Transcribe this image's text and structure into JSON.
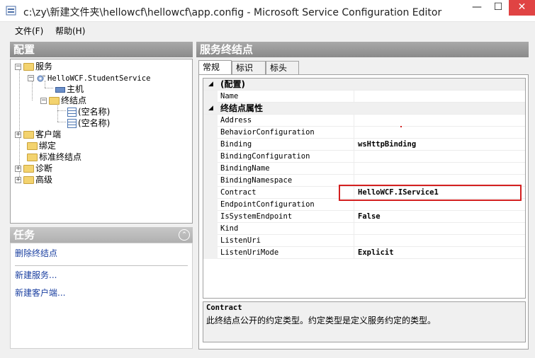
{
  "window": {
    "title": "c:\\zy\\新建文件夹\\hellowcf\\hellowcf\\app.config - Microsoft Service Configuration Editor",
    "min": "—",
    "max": "☐",
    "close": "✕"
  },
  "menu": {
    "file": "文件(F)",
    "help": "帮助(H)"
  },
  "left": {
    "header": "配置",
    "tree": {
      "services": "服务",
      "service_name": "HelloWCF.StudentService",
      "host": "主机",
      "endpoints": "终结点",
      "endpoint1": "(空名称)",
      "endpoint2": "(空名称)",
      "client": "客户端",
      "bindings": "绑定",
      "standard_endpoints": "标准终结点",
      "diagnostics": "诊断",
      "advanced": "高级"
    },
    "tasks": {
      "header": "任务",
      "collapse": "⌃",
      "delete_endpoint": "删除终结点",
      "new_service": "新建服务...",
      "new_client": "新建客户端..."
    }
  },
  "right": {
    "header": "服务终结点",
    "tabs": [
      "常规",
      "标识",
      "标头"
    ],
    "categories": {
      "config": "(配置)",
      "props": "终结点属性"
    },
    "props": [
      {
        "name": "Name",
        "value": ""
      },
      {
        "name": "Address",
        "value": ""
      },
      {
        "name": "BehaviorConfiguration",
        "value": ""
      },
      {
        "name": "Binding",
        "value": "wsHttpBinding"
      },
      {
        "name": "BindingConfiguration",
        "value": ""
      },
      {
        "name": "BindingName",
        "value": ""
      },
      {
        "name": "BindingNamespace",
        "value": ""
      },
      {
        "name": "Contract",
        "value": "HelloWCF.IService1"
      },
      {
        "name": "EndpointConfiguration",
        "value": ""
      },
      {
        "name": "IsSystemEndpoint",
        "value": "False"
      },
      {
        "name": "Kind",
        "value": ""
      },
      {
        "name": "ListenUri",
        "value": ""
      },
      {
        "name": "ListenUriMode",
        "value": "Explicit"
      }
    ],
    "description": {
      "title": "Contract",
      "text": "此终结点公开的约定类型。约定类型是定义服务约定的类型。"
    }
  }
}
